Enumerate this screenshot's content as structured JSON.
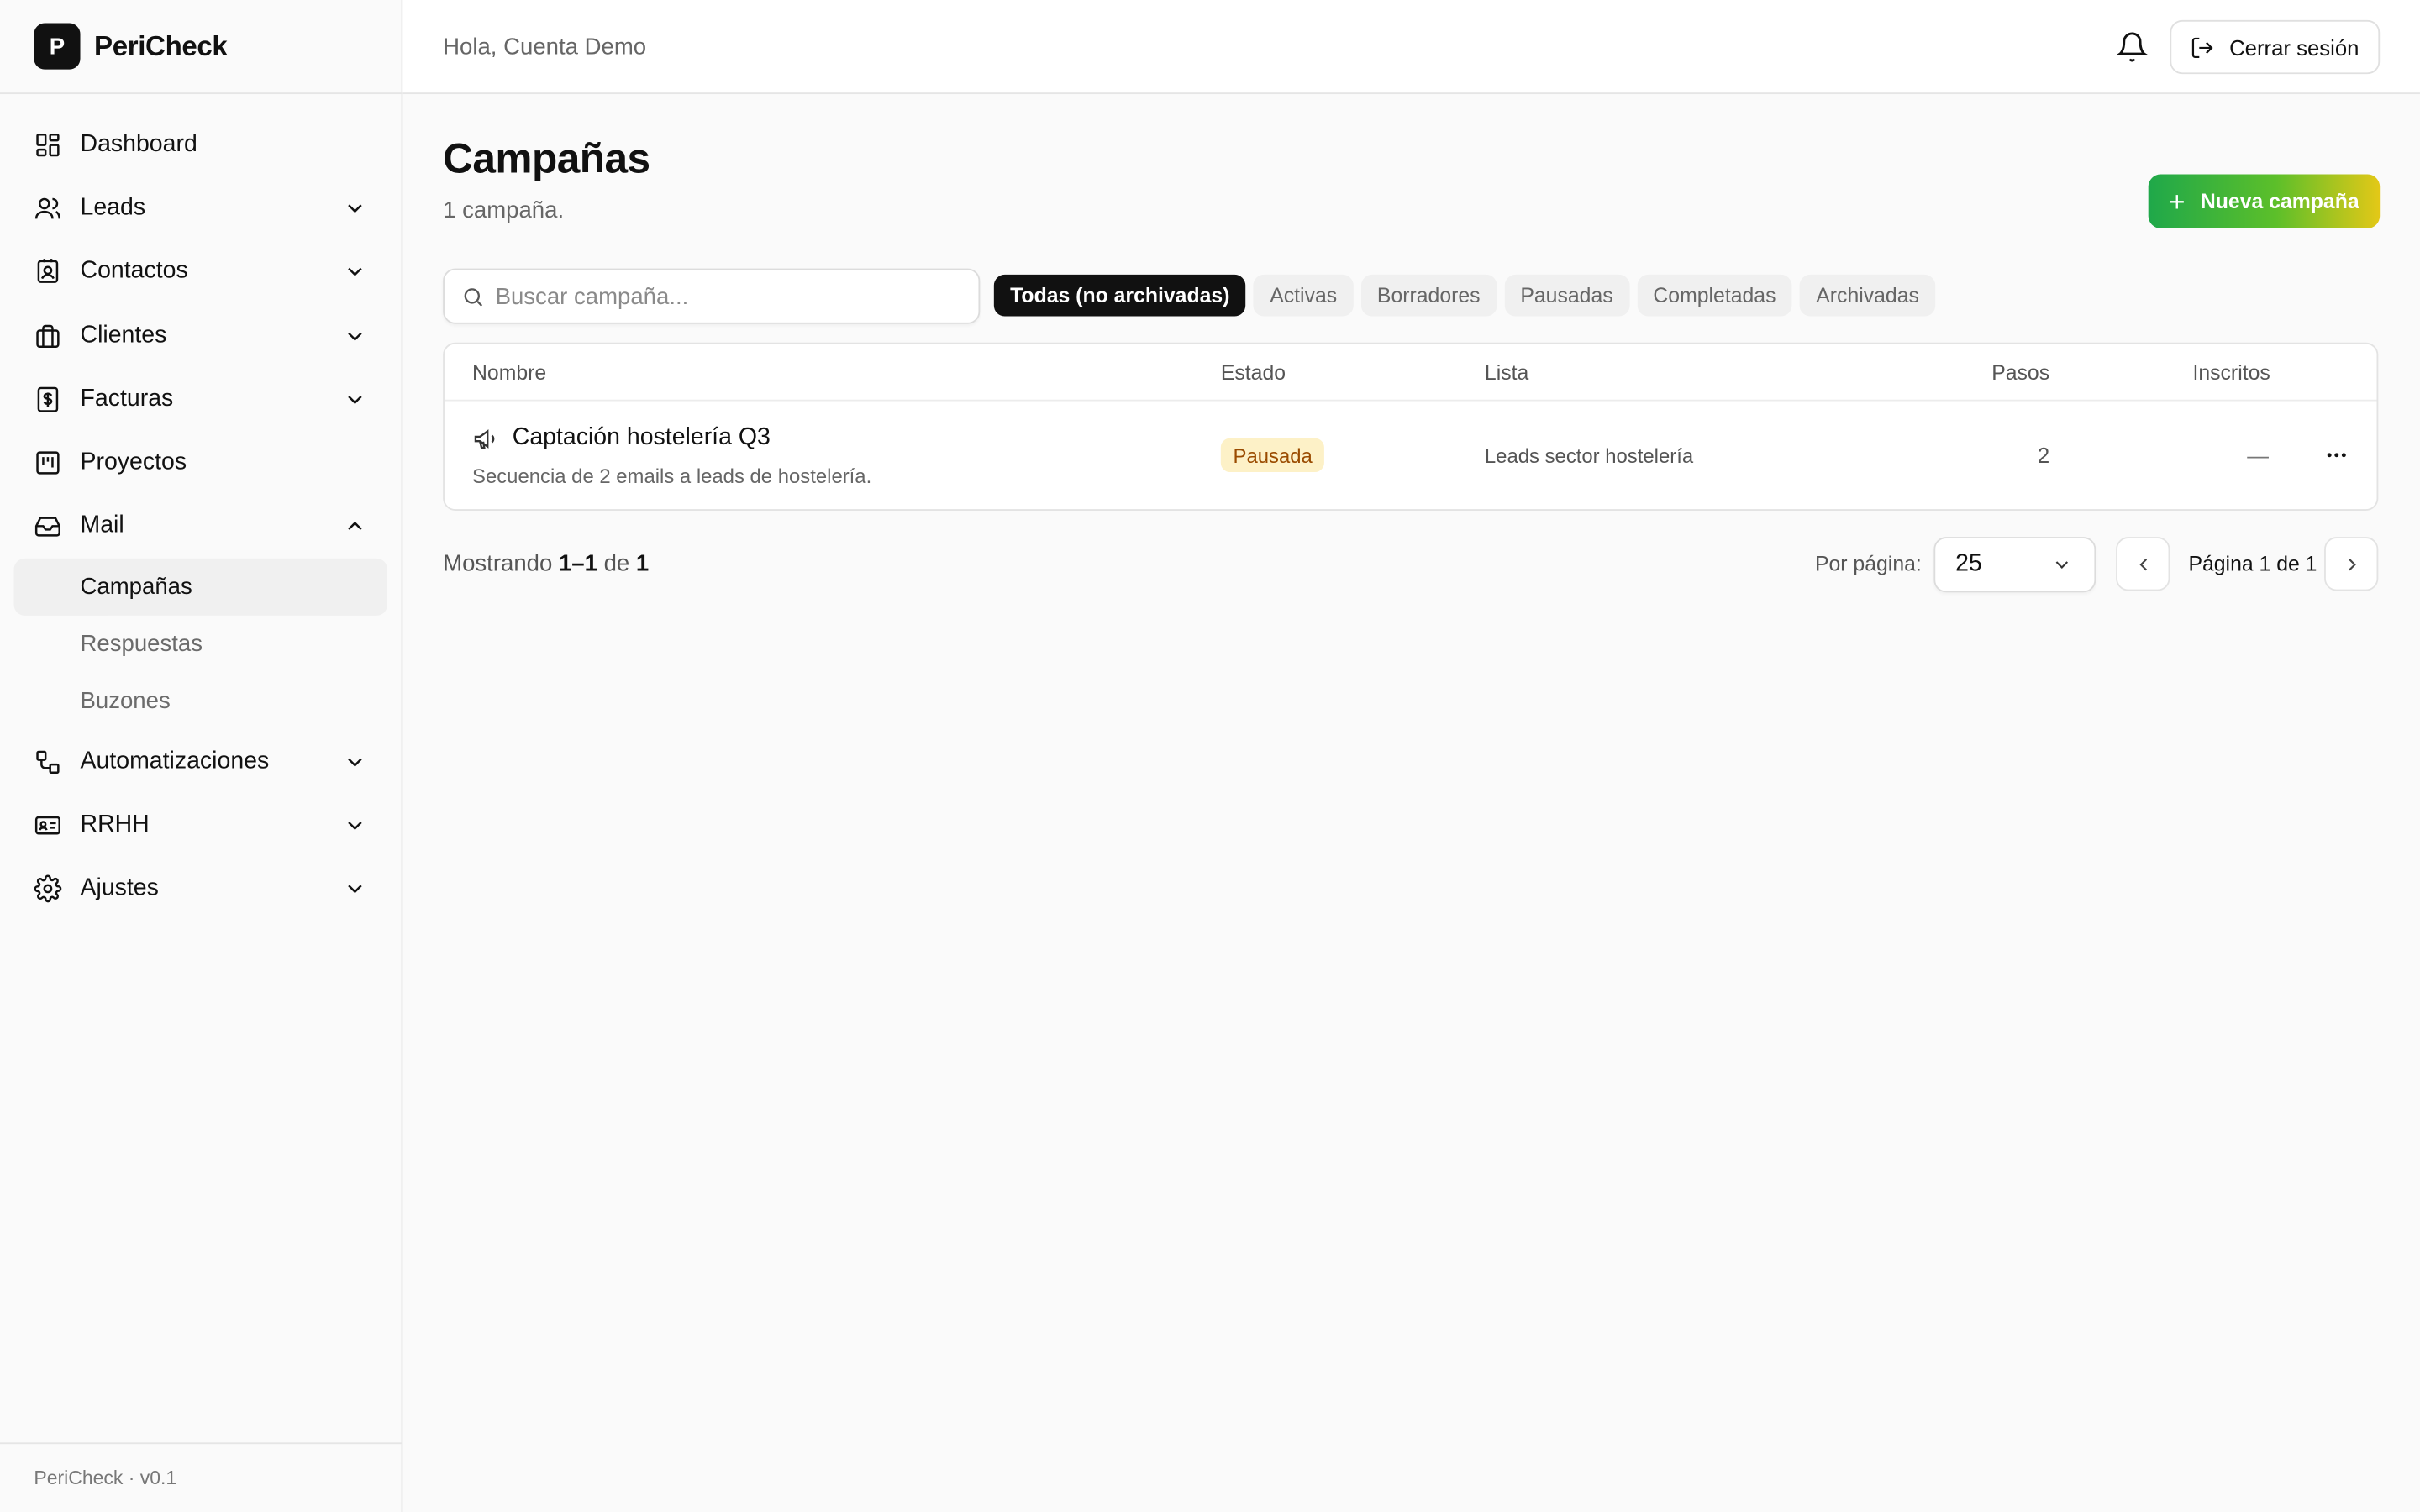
{
  "brand": {
    "logo_letter": "P",
    "name": "PeriCheck"
  },
  "sidebar": {
    "items": [
      {
        "label": "Dashboard",
        "icon": "dashboard-icon"
      },
      {
        "label": "Leads",
        "icon": "users-icon"
      },
      {
        "label": "Contactos",
        "icon": "contact-book-icon"
      },
      {
        "label": "Clientes",
        "icon": "briefcase-icon"
      },
      {
        "label": "Facturas",
        "icon": "invoice-icon"
      },
      {
        "label": "Proyectos",
        "icon": "kanban-icon"
      },
      {
        "label": "Mail",
        "icon": "inbox-icon"
      },
      {
        "label": "Automatizaciones",
        "icon": "workflow-icon"
      },
      {
        "label": "RRHH",
        "icon": "id-card-icon"
      },
      {
        "label": "Ajustes",
        "icon": "gear-icon"
      }
    ],
    "mail_sub": [
      "Campañas",
      "Respuestas",
      "Buzones"
    ],
    "footer": "PeriCheck · v0.1"
  },
  "topbar": {
    "greeting": "Hola, Cuenta Demo",
    "logout_label": "Cerrar sesión"
  },
  "page": {
    "title": "Campañas",
    "subtitle": "1 campaña.",
    "new_button": "Nueva campaña",
    "search_placeholder": "Buscar campaña...",
    "filters": [
      "Todas (no archivadas)",
      "Activas",
      "Borradores",
      "Pausadas",
      "Completadas",
      "Archivadas"
    ]
  },
  "table": {
    "columns": [
      "Nombre",
      "Estado",
      "Lista",
      "Pasos",
      "Inscritos"
    ],
    "rows": [
      {
        "name": "Captación hostelería Q3",
        "description": "Secuencia de 2 emails a leads de hostelería.",
        "status": "Pausada",
        "list": "Leads sector hostelería",
        "steps": "2",
        "enrolled": "—"
      }
    ]
  },
  "pagination": {
    "showing_prefix": "Mostrando ",
    "showing_range": "1–1",
    "showing_mid": " de ",
    "showing_total": "1",
    "per_page_label": "Por página:",
    "per_page_value": "25",
    "page_info": "Página 1 de 1"
  },
  "colors": {
    "accent_start": "#1fa84a",
    "accent_end": "#e3c817",
    "status_paused_bg": "#fdf1c7",
    "status_paused_text": "#9a4b00"
  }
}
